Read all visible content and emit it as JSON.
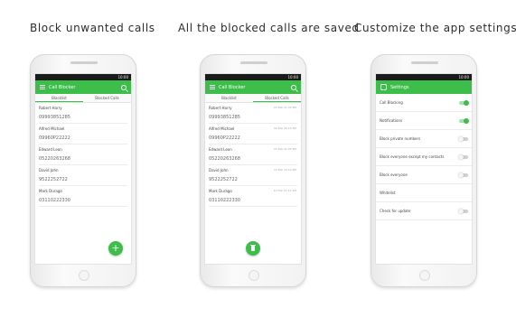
{
  "captions": [
    "Block unwanted calls",
    "All the blocked calls are saved",
    "Customize the app settings"
  ],
  "status_time": "10:00",
  "app_title": "Call Blocker",
  "settings_title": "Settings",
  "tabs": [
    "Blacklist",
    "Blocked Calls"
  ],
  "contacts": [
    {
      "name": "Robert Harry",
      "number": "09993851285",
      "date": "03 Feb 21:05 PM"
    },
    {
      "name": "Alfred Michael",
      "number": "09960P22222",
      "date": "09 Feb 05:15 PM"
    },
    {
      "name": "Edward Leon",
      "number": "05220263268",
      "date": "03 Feb 21:05 PM"
    },
    {
      "name": "David John",
      "number": "9522252722",
      "date": "04 Feb 15:14 PM"
    },
    {
      "name": "Mark Durago",
      "number": "03110222330",
      "date": "10 Feb 11:12 AM"
    }
  ],
  "settings": [
    {
      "label": "Call Blocking",
      "on": true,
      "toggle": true
    },
    {
      "label": "Notifications",
      "on": true,
      "toggle": true
    },
    {
      "label": "Block private numbers",
      "on": false,
      "toggle": true
    },
    {
      "label": "Block everyone except my contacts",
      "on": false,
      "toggle": true
    },
    {
      "label": "Block everyone",
      "on": false,
      "toggle": true
    },
    {
      "label": "Whitelist",
      "on": false,
      "toggle": false
    },
    {
      "label": "Check for update",
      "on": false,
      "toggle": true
    }
  ],
  "fab_label": "+",
  "colors": {
    "accent": "#3dbd4a",
    "status_bar": "#1b1b1b"
  }
}
